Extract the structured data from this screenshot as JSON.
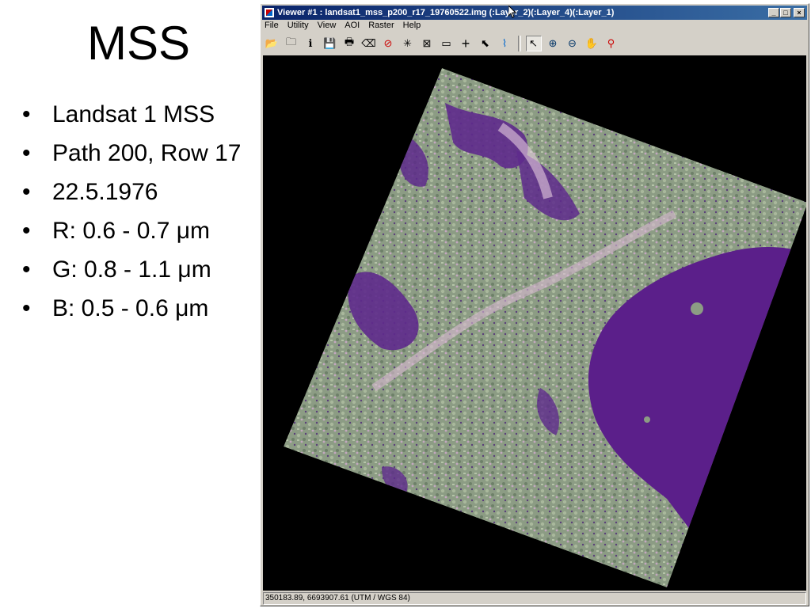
{
  "slide": {
    "title": "MSS",
    "bullets": [
      "Landsat 1 MSS",
      "Path 200, Row 17",
      "22.5.1976",
      "R: 0.6 - 0.7 μm",
      "G: 0.8 - 1.1 μm",
      "B: 0.5 - 0.6 μm"
    ],
    "bullet_char": "•"
  },
  "viewer": {
    "title": "Viewer #1 : landsat1_mss_p200_r17_19760522.img (:Layer_2)(:Layer_4)(:Layer_1)",
    "window_buttons": {
      "minimize": "_",
      "maximize": "□",
      "close": "×"
    },
    "menu": [
      {
        "label": "File",
        "icon": ""
      },
      {
        "label": "Utility",
        "icon": ""
      },
      {
        "label": "View",
        "icon": ""
      },
      {
        "label": "AOI",
        "icon": ""
      },
      {
        "label": "Raster",
        "icon": ""
      },
      {
        "label": "Help",
        "icon": ""
      }
    ],
    "toolbar": [
      {
        "icon": "open-folder-icon",
        "glyph": "📂"
      },
      {
        "icon": "open-layer-icon",
        "glyph": "🗀"
      },
      {
        "icon": "info-icon",
        "glyph": "ℹ"
      },
      {
        "icon": "save-icon",
        "glyph": "💾"
      },
      {
        "icon": "print-icon",
        "glyph": "🖶"
      },
      {
        "icon": "eraser-icon",
        "glyph": "⌫"
      },
      {
        "icon": "stop-icon",
        "glyph": "⊘"
      },
      {
        "icon": "zoom-extent-icon",
        "glyph": "✳"
      },
      {
        "icon": "fit-icon",
        "glyph": "⊠"
      },
      {
        "icon": "measure-icon",
        "glyph": "▭"
      },
      {
        "icon": "crosshair-icon",
        "glyph": "+"
      },
      {
        "icon": "arrow-tool-icon",
        "glyph": "⬉"
      },
      {
        "icon": "profile-icon",
        "glyph": "⌇"
      },
      {
        "icon": "select-pointer-icon",
        "glyph": "↖"
      },
      {
        "icon": "zoom-in-icon",
        "glyph": "⊕"
      },
      {
        "icon": "zoom-out-icon",
        "glyph": "⊖"
      },
      {
        "icon": "pan-hand-icon",
        "glyph": "✋"
      },
      {
        "icon": "link-icon",
        "glyph": "⚲"
      }
    ],
    "status": "350183.89, 6693907.61    (UTM / WGS 84)",
    "colors": {
      "title_start": "#0a246a",
      "title_end": "#3a6ea5",
      "chrome": "#d4d0c8",
      "water": "#5b1f8a",
      "land": "#8fa087",
      "background": "#000000"
    }
  }
}
